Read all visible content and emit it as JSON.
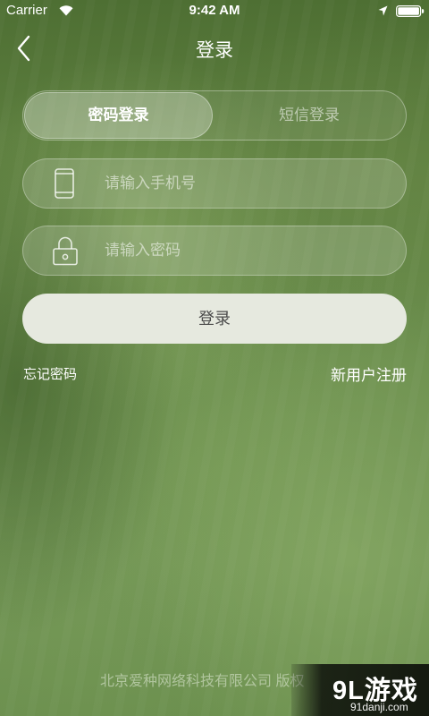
{
  "status_bar": {
    "carrier": "Carrier",
    "time": "9:42 AM",
    "icons": [
      "wifi-icon",
      "location-arrow-icon",
      "battery-icon"
    ]
  },
  "nav": {
    "back_icon": "chevron-left-icon",
    "title": "登录"
  },
  "login_tabs": [
    {
      "label": "密码登录",
      "selected": true
    },
    {
      "label": "短信登录",
      "selected": false
    }
  ],
  "form": {
    "phone": {
      "icon": "phone-icon",
      "value": "",
      "placeholder": "请输入手机号"
    },
    "password": {
      "icon": "lock-icon",
      "value": "",
      "placeholder": "请输入密码"
    },
    "submit_label": "登录"
  },
  "links": {
    "forgot_password": "忘记密码",
    "register": "新用户注册"
  },
  "footer": {
    "copyright": "北京爱种网络科技有限公司 版权"
  },
  "watermark": {
    "logo": "9L游戏",
    "site": "91danji.com"
  },
  "colors": {
    "background": "#6c8f4e",
    "submit_button_bg": "#e6e9df",
    "submit_button_text": "#4a4a4a",
    "text": "#ffffff"
  }
}
